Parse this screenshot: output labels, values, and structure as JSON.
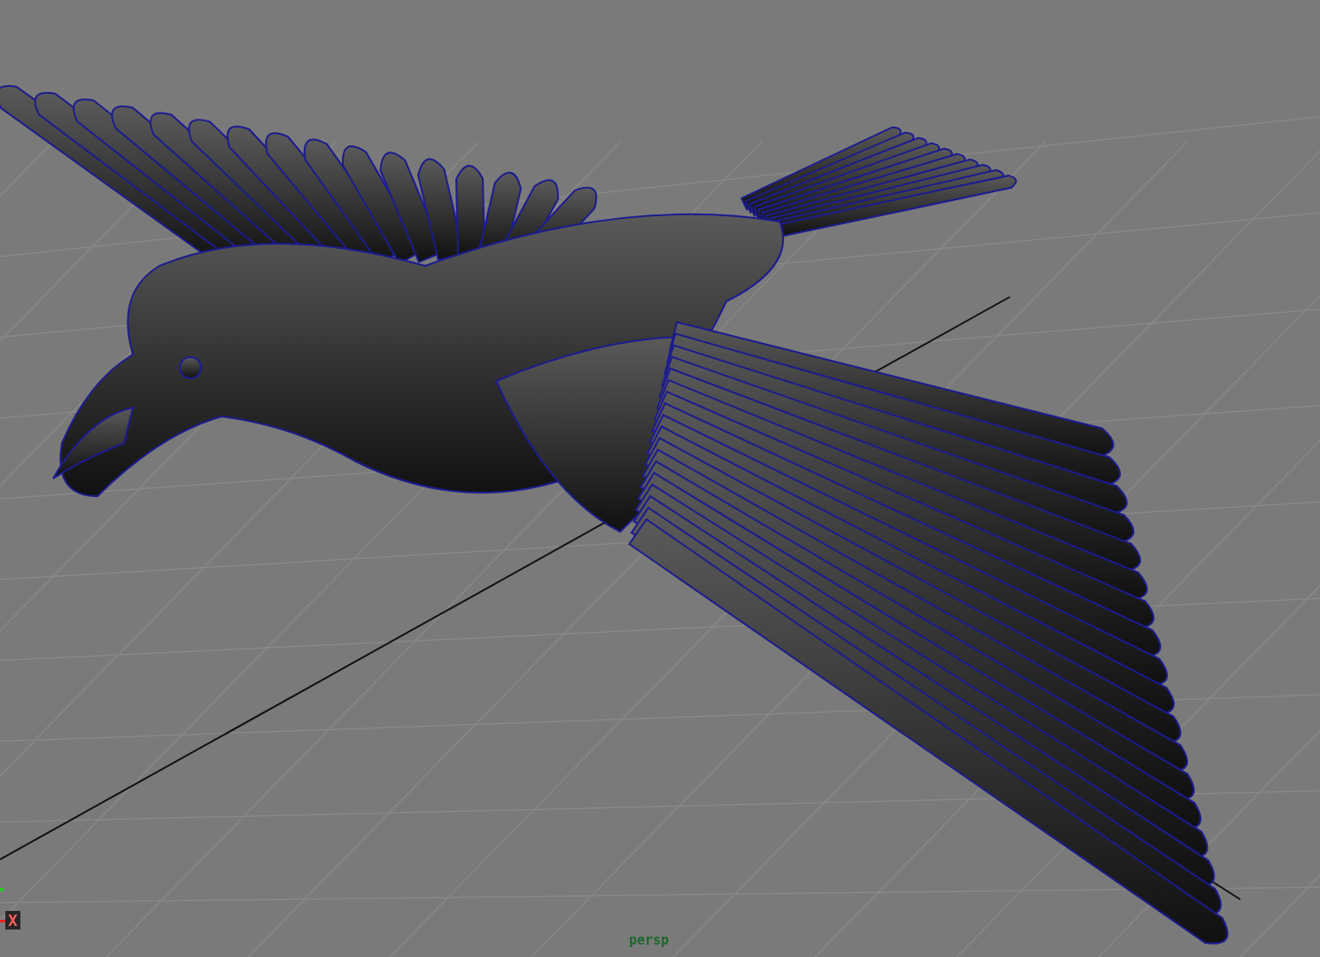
{
  "viewport": {
    "camera_label": "persp",
    "axis_label": "X"
  }
}
